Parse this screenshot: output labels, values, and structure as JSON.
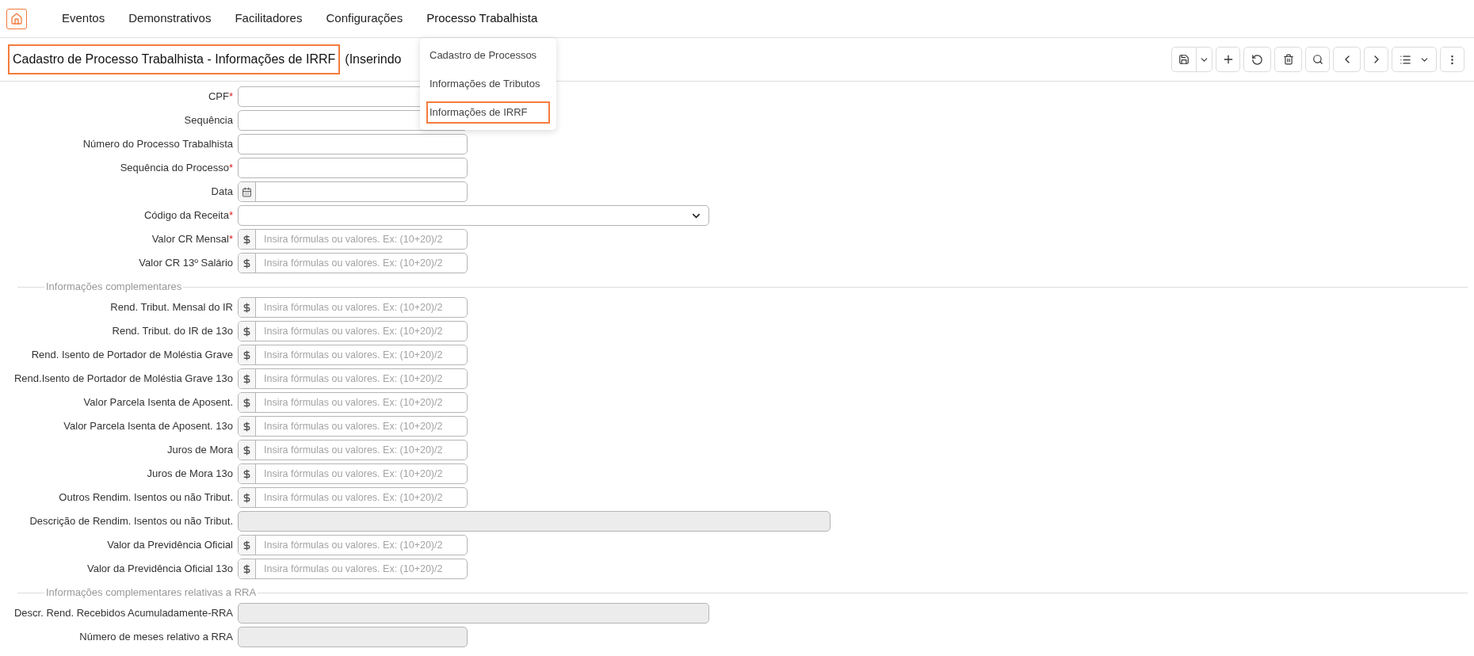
{
  "nav": {
    "items": [
      {
        "label": "Eventos"
      },
      {
        "label": "Demonstrativos"
      },
      {
        "label": "Facilitadores"
      },
      {
        "label": "Configurações"
      },
      {
        "label": "Processo Trabalhista",
        "expanded": true
      }
    ]
  },
  "menu": {
    "items": [
      {
        "label": "Cadastro de Processos",
        "selected": false
      },
      {
        "label": "Informações de Tributos",
        "selected": false
      },
      {
        "label": "Informações de IRRF",
        "selected": true
      }
    ]
  },
  "page_title": {
    "text": "Cadastro de Processo Trabalhista - Informações de IRRF",
    "highlighted": true,
    "status": "(Inserindo"
  },
  "sections": [
    {
      "fields": [
        {
          "label": "CPF",
          "marker": "*",
          "kind": "text",
          "disabled": false
        },
        {
          "label": "Sequência",
          "kind": "text",
          "disabled": false
        },
        {
          "label": "Número do Processo Trabalhista",
          "kind": "text",
          "disabled": false
        },
        {
          "label": "Sequência do Processo",
          "marker": "*",
          "kind": "text",
          "disabled": false
        },
        {
          "label": "Data",
          "kind": "date",
          "disabled": false
        },
        {
          "label": "Código da Receita",
          "marker": "*",
          "kind": "select",
          "disabled": false
        },
        {
          "label": "Valor CR Mensal",
          "marker": "*",
          "kind": "currency",
          "disabled": false,
          "placeholder": "Insira fórmulas ou valores. Ex: (10+20)/2"
        },
        {
          "label": "Valor CR 13º Salário",
          "kind": "currency",
          "disabled": false,
          "placeholder": "Insira fórmulas ou valores. Ex: (10+20)/2"
        }
      ]
    },
    {
      "title": "Informações complementares",
      "fields": [
        {
          "label": "Rend. Tribut. Mensal do IR",
          "kind": "currency",
          "disabled": false,
          "placeholder": "Insira fórmulas ou valores. Ex: (10+20)/2"
        },
        {
          "label": "Rend. Tribut. do IR de 13o",
          "kind": "currency",
          "disabled": false,
          "placeholder": "Insira fórmulas ou valores. Ex: (10+20)/2"
        },
        {
          "label": "Rend. Isento de Portador de Moléstia Grave",
          "kind": "currency",
          "disabled": false,
          "placeholder": "Insira fórmulas ou valores. Ex: (10+20)/2"
        },
        {
          "label": "Rend.Isento de Portador de Moléstia Grave 13o",
          "kind": "currency",
          "disabled": false,
          "placeholder": "Insira fórmulas ou valores. Ex: (10+20)/2"
        },
        {
          "label": "Valor Parcela Isenta de Aposent.",
          "kind": "currency",
          "disabled": false,
          "placeholder": "Insira fórmulas ou valores. Ex: (10+20)/2"
        },
        {
          "label": "Valor Parcela Isenta de Aposent. 13o",
          "kind": "currency",
          "disabled": false,
          "placeholder": "Insira fórmulas ou valores. Ex: (10+20)/2"
        },
        {
          "label": "Juros de Mora",
          "kind": "currency",
          "disabled": false,
          "placeholder": "Insira fórmulas ou valores. Ex: (10+20)/2"
        },
        {
          "label": "Juros de Mora 13o",
          "kind": "currency",
          "disabled": false,
          "placeholder": "Insira fórmulas ou valores. Ex: (10+20)/2"
        },
        {
          "label": "Outros Rendim. Isentos ou não Tribut.",
          "kind": "currency",
          "disabled": false,
          "placeholder": "Insira fórmulas ou valores. Ex: (10+20)/2"
        },
        {
          "label": "Descrição de Rendim. Isentos ou não Tribut.",
          "kind": "memo",
          "disabled": true
        },
        {
          "label": "Valor da Previdência Oficial",
          "kind": "currency",
          "disabled": false,
          "placeholder": "Insira fórmulas ou valores. Ex: (10+20)/2"
        },
        {
          "label": "Valor da Previdência Oficial 13o",
          "kind": "currency",
          "disabled": false,
          "placeholder": "Insira fórmulas ou valores. Ex: (10+20)/2"
        }
      ]
    },
    {
      "title": "Informações complementares relativas a RRA",
      "fields": [
        {
          "label": "Descr. Rend. Recebidos Acumuladamente-RRA",
          "kind": "note",
          "disabled": true
        },
        {
          "label": "Número de meses relativo a RRA",
          "kind": "text",
          "disabled": true
        }
      ]
    }
  ]
}
